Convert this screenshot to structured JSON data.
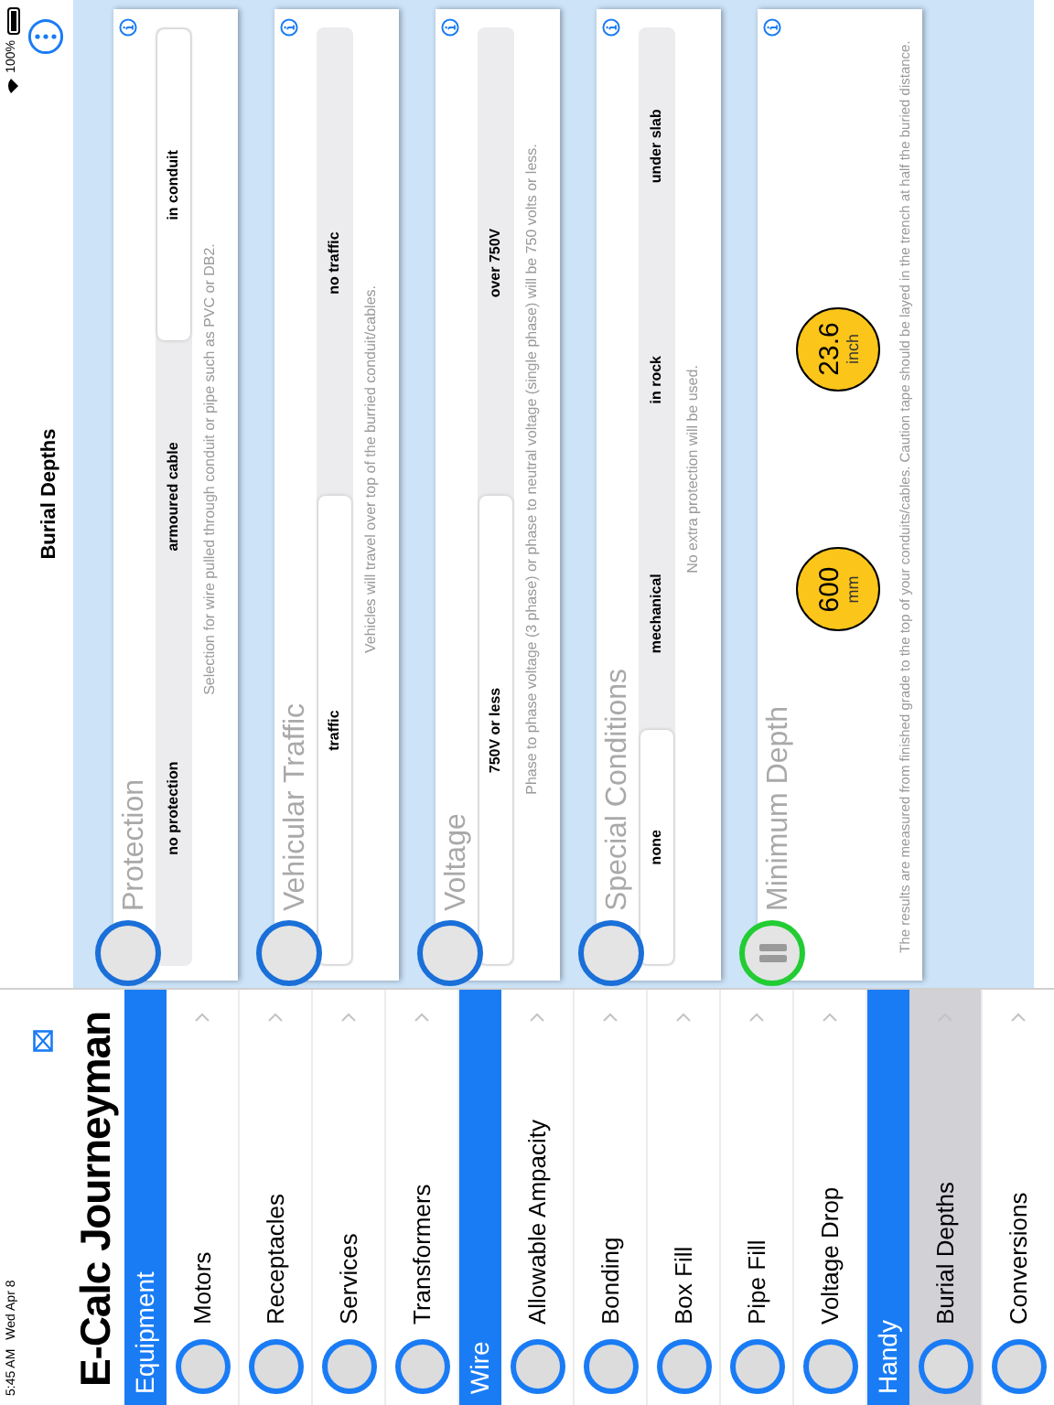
{
  "status_bar": {
    "time": "5:45 AM",
    "date": "Wed Apr 8",
    "battery": "100%"
  },
  "sidebar": {
    "title": "E-Calc Journeyman",
    "sections": [
      {
        "title": "Equipment",
        "items": [
          {
            "label": "Motors",
            "selected": false
          },
          {
            "label": "Receptacles",
            "selected": false
          },
          {
            "label": "Services",
            "selected": false
          },
          {
            "label": "Transformers",
            "selected": false
          }
        ]
      },
      {
        "title": "Wire",
        "items": [
          {
            "label": "Allowable Ampacity",
            "selected": false
          },
          {
            "label": "Bonding",
            "selected": false
          },
          {
            "label": "Box Fill",
            "selected": false
          },
          {
            "label": "Pipe Fill",
            "selected": false
          },
          {
            "label": "Voltage Drop",
            "selected": false
          }
        ]
      },
      {
        "title": "Handy",
        "items": [
          {
            "label": "Burial Depths",
            "selected": true
          },
          {
            "label": "Conversions",
            "selected": false
          }
        ]
      }
    ]
  },
  "nav": {
    "title": "Burial Depths"
  },
  "cards": [
    {
      "kind": "segmented",
      "title": "Protection",
      "options": [
        {
          "label": "no protection",
          "selected": false
        },
        {
          "label": "armoured cable",
          "selected": false
        },
        {
          "label": "in conduit",
          "selected": true
        }
      ],
      "description": "Selection for wire pulled through conduit or pipe such as PVC or DB2."
    },
    {
      "kind": "segmented",
      "title": "Vehicular Traffic",
      "options": [
        {
          "label": "traffic",
          "selected": true
        },
        {
          "label": "no traffic",
          "selected": false
        }
      ],
      "description": "Vehicles will travel over top of the burried conduit/cables."
    },
    {
      "kind": "segmented",
      "title": "Voltage",
      "options": [
        {
          "label": "750V or less",
          "selected": true
        },
        {
          "label": "over 750V",
          "selected": false
        }
      ],
      "description": "Phase to phase voltage (3 phase) or phase to neutral voltage (single phase) will be 750 volts or less."
    },
    {
      "kind": "segmented",
      "title": "Special Conditions",
      "options": [
        {
          "label": "none",
          "selected": true
        },
        {
          "label": "mechanical",
          "selected": false
        },
        {
          "label": "in rock",
          "selected": false
        },
        {
          "label": "under slab",
          "selected": false
        }
      ],
      "description": "No extra protection will be used."
    },
    {
      "kind": "result",
      "title": "Minimum Depth",
      "results": [
        {
          "value": "600",
          "unit": "mm"
        },
        {
          "value": "23.6",
          "unit": "inch"
        }
      ],
      "description": "The results are measured from finished grade to the top of your conduits/cables. Caution tape should be layed in the trench at half the buried distance."
    }
  ]
}
